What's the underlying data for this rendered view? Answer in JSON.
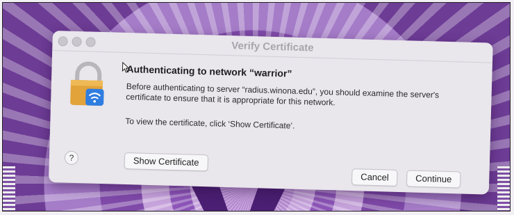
{
  "window": {
    "title": "Verify Certificate"
  },
  "dialog": {
    "heading": "Authenticating to network “warrior”",
    "message": "Before authenticating to server “radius.winona.edu”, you should examine the server's certificate to ensure that it is appropriate for this network.",
    "instruction": "To view the certificate, click ‘Show Certificate’.",
    "icon": "wifi-lock-icon"
  },
  "buttons": {
    "help": "?",
    "show_certificate": "Show Certificate",
    "cancel": "Cancel",
    "continue": "Continue"
  },
  "colors": {
    "wallpaper_purple": "#7f4aa8",
    "lock_gold": "#e2a33a",
    "wifi_blue": "#2f7de1"
  }
}
